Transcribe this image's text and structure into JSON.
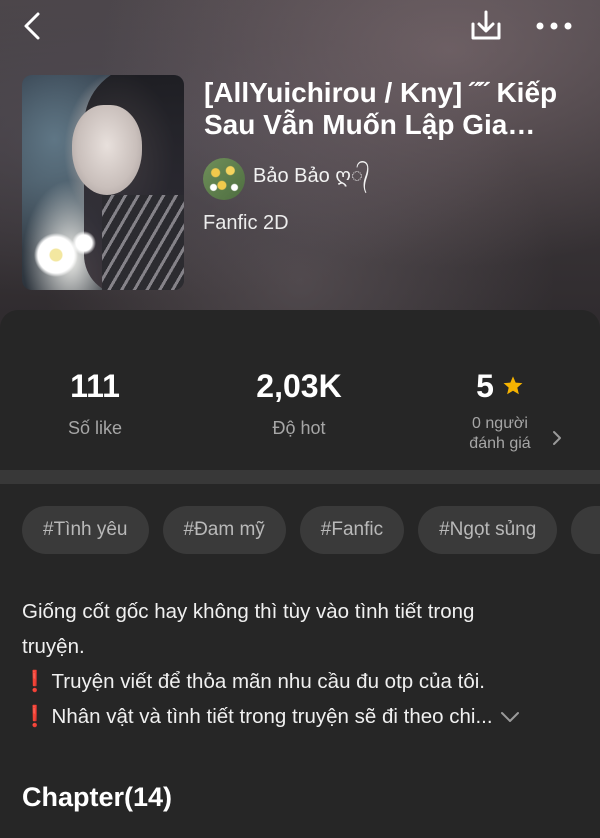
{
  "header": {
    "back_icon": "chevron-left-icon",
    "download_icon": "download-icon",
    "more_icon": "more-horizontal-icon"
  },
  "story": {
    "title": "[AllYuichirou / Kny] ˝˝ Kiếp Sau Vẫn Muốn Lập Gia Đình",
    "author": "Bảo Bảo ღ᭄",
    "genre": "Fanfic 2D"
  },
  "stats": {
    "likes_value": "111",
    "likes_label": "Số like",
    "hot_value": "2,03K",
    "hot_label": "Độ hot",
    "rating_value": "5",
    "rating_sub_1": "0 người",
    "rating_sub_2": "đánh giá",
    "star_color": "#F5B301"
  },
  "tags": [
    "#Tình yêu",
    "#Đam mỹ",
    "#Fanfic",
    "#Ngọt sủng"
  ],
  "description": {
    "line1": "Giống cốt gốc hay không thì tùy vào tình tiết trong",
    "line2": "truyện.",
    "line3": "Truyện viết để thỏa mãn nhu cầu đu otp của tôi.",
    "line4": "Nhân vật và tình tiết trong truyện sẽ đi theo chi...",
    "warning_icon": "❗"
  },
  "chapters": {
    "heading": "Chapter(14)"
  }
}
